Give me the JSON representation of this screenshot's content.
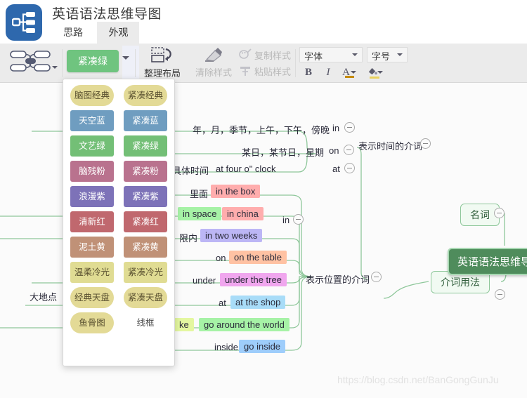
{
  "titlebar": {
    "doc_title": "英语语法思维导图",
    "logo_icon": "mindmap-logo-icon",
    "tabs": [
      {
        "label": "思路",
        "active": false
      },
      {
        "label": "外观",
        "active": true
      }
    ]
  },
  "ribbon": {
    "structure": {
      "icon": "mindmap-structure-icon",
      "caret": "chevron-down-icon"
    },
    "theme": {
      "label": "紧凑绿",
      "caret": "chevron-down-icon",
      "color": "#6fc47f"
    },
    "layout": {
      "icon": "arrange-layout-icon",
      "label": "整理布局"
    },
    "clear_style": {
      "icon": "clear-style-icon",
      "label": "清除样式"
    },
    "copy_style": {
      "icon": "copy-style-icon",
      "label": "复制样式"
    },
    "paste_style": {
      "icon": "paste-style-icon",
      "label": "粘贴样式"
    },
    "font_face": {
      "label": "字体",
      "caret": "chevron-down-icon"
    },
    "font_size": {
      "label": "字号",
      "caret": "chevron-down-icon"
    },
    "bold": "B",
    "italic": "I",
    "font_color": "A",
    "fill_color": "fill-bucket-icon"
  },
  "theme_panel": {
    "rows": [
      [
        {
          "label": "脑图经典",
          "color": "#e3da96",
          "shape": "round",
          "text": "dark"
        },
        {
          "label": "紧凑经典",
          "color": "#e3da96",
          "shape": "round",
          "text": "dark"
        }
      ],
      [
        {
          "label": "天空蓝",
          "color": "#6f9dc0",
          "shape": "rect",
          "text": "light"
        },
        {
          "label": "紧凑蓝",
          "color": "#6f9dc0",
          "shape": "rect",
          "text": "light"
        }
      ],
      [
        {
          "label": "文艺绿",
          "color": "#73bf76",
          "shape": "rect",
          "text": "light"
        },
        {
          "label": "紧凑绿",
          "color": "#73bf76",
          "shape": "rect",
          "text": "light"
        }
      ],
      [
        {
          "label": "脑残粉",
          "color": "#b9728e",
          "shape": "rect",
          "text": "light"
        },
        {
          "label": "紧凑粉",
          "color": "#b9728e",
          "shape": "rect",
          "text": "light"
        }
      ],
      [
        {
          "label": "浪漫紫",
          "color": "#7d72b8",
          "shape": "rect",
          "text": "light"
        },
        {
          "label": "紧凑紫",
          "color": "#7d72b8",
          "shape": "rect",
          "text": "light"
        }
      ],
      [
        {
          "label": "清新红",
          "color": "#c0686e",
          "shape": "rect",
          "text": "light"
        },
        {
          "label": "紧凑红",
          "color": "#c0686e",
          "shape": "rect",
          "text": "light"
        }
      ],
      [
        {
          "label": "泥土黄",
          "color": "#c09177",
          "shape": "rect",
          "text": "light"
        },
        {
          "label": "紧凑黄",
          "color": "#c09177",
          "shape": "rect",
          "text": "light"
        }
      ],
      [
        {
          "label": "温柔冷光",
          "color": "#e0dc93",
          "shape": "rect",
          "text": "dark"
        },
        {
          "label": "紧凑冷光",
          "color": "#e0dc93",
          "shape": "rect",
          "text": "dark"
        }
      ],
      [
        {
          "label": "经典天盘",
          "color": "#e3da96",
          "shape": "round",
          "text": "dark"
        },
        {
          "label": "紧凑天盘",
          "color": "#e3da96",
          "shape": "round",
          "text": "dark"
        }
      ],
      [
        {
          "label": "鱼骨图",
          "color": "#e3da96",
          "shape": "round",
          "text": "dark"
        },
        {
          "label": "线框",
          "color": "transparent",
          "shape": "rect",
          "text": "plain"
        }
      ]
    ]
  },
  "mindmap": {
    "root": "英语语法思维导图",
    "branches": [
      {
        "name": "noun-branch",
        "label": "名词"
      },
      {
        "name": "preposition-usage-branch",
        "label": "介词用法"
      }
    ],
    "groups": [
      {
        "name": "time-preposition-group",
        "label": "表示时间的介词"
      },
      {
        "name": "place-preposition-group",
        "label": "表示位置的介词"
      }
    ],
    "keys": [
      {
        "name": "key-in-time",
        "label": "in"
      },
      {
        "name": "key-on-time",
        "label": "on"
      },
      {
        "name": "key-at-time",
        "label": "at"
      },
      {
        "name": "key-in-place",
        "label": "in"
      },
      {
        "name": "key-on-place",
        "label": "on"
      },
      {
        "name": "key-under",
        "label": "under"
      },
      {
        "name": "key-at-place",
        "label": "at"
      },
      {
        "name": "key-inside",
        "label": "inside"
      }
    ],
    "leaves": [
      {
        "name": "leaf-time-in",
        "text": "年，月，季节，上午，下午，傍晚",
        "fill": "none"
      },
      {
        "name": "leaf-time-on",
        "text": "某日，某节日，星期",
        "fill": "none"
      },
      {
        "name": "leaf-time-at-cn",
        "text": "具体时间",
        "fill": "none"
      },
      {
        "name": "leaf-time-at-en",
        "text": "at four o\" clock",
        "fill": "none"
      },
      {
        "name": "leaf-inside-cn",
        "text": "里面",
        "fill": "none"
      },
      {
        "name": "leaf-in-the-box",
        "text": "in the box",
        "fill": "#ffadad"
      },
      {
        "name": "leaf-in-space",
        "text": "in space",
        "fill": "#a6f2a6"
      },
      {
        "name": "leaf-in-china",
        "text": "in china",
        "fill": "#ffadad"
      },
      {
        "name": "leaf-within-cn",
        "text": "限内",
        "fill": "none"
      },
      {
        "name": "leaf-in-two-weeks",
        "text": "in two weeks",
        "fill": "#bcb6f5"
      },
      {
        "name": "leaf-on-the-table",
        "text": "on the table",
        "fill": "#ffc2a3"
      },
      {
        "name": "leaf-under-the-tree",
        "text": "under the tree",
        "fill": "#f0a6ee"
      },
      {
        "name": "leaf-at-the-shop",
        "text": "at the shop",
        "fill": "#a8dcf8"
      },
      {
        "name": "leaf-like",
        "text": "ke",
        "fill": "#e4f7a0"
      },
      {
        "name": "leaf-go-around-the-world",
        "text": "go around the world",
        "fill": "#a6f2a6"
      },
      {
        "name": "leaf-go-inside",
        "text": "go inside",
        "fill": "#9ecdfb"
      },
      {
        "name": "leaf-big-place",
        "text": "大地点",
        "fill": "none"
      }
    ],
    "watermark": "https://blog.csdn.net/BanGongGunJu"
  }
}
